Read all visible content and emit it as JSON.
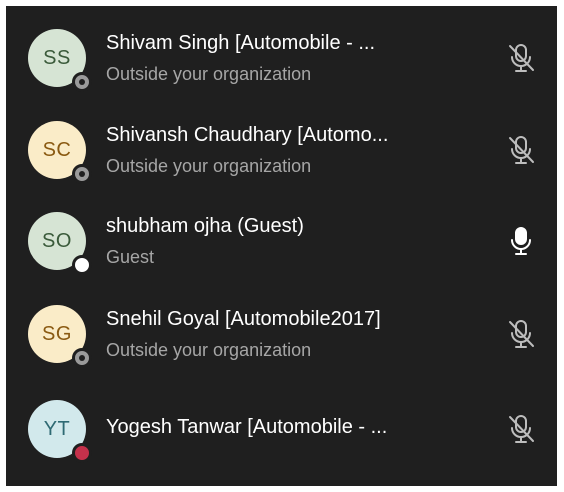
{
  "participants": [
    {
      "initials": "SS",
      "name": "Shivam Singh [Automobile - ...",
      "subtitle": "Outside your organization",
      "avatar_bg": "#d6e4d4",
      "avatar_fg": "#3a5a3a",
      "status": "unknown",
      "mic": "mic-off-icon"
    },
    {
      "initials": "SC",
      "name": "Shivansh Chaudhary [Automo...",
      "subtitle": "Outside your organization",
      "avatar_bg": "#faecc8",
      "avatar_fg": "#8a5a12",
      "status": "unknown",
      "mic": "mic-off-icon"
    },
    {
      "initials": "SO",
      "name": "shubham ojha (Guest)",
      "subtitle": "Guest",
      "avatar_bg": "#d6e4d4",
      "avatar_fg": "#3a5a3a",
      "status": "available",
      "mic": "mic-on-icon"
    },
    {
      "initials": "SG",
      "name": "Snehil Goyal [Automobile2017]",
      "subtitle": "Outside your organization",
      "avatar_bg": "#faecc8",
      "avatar_fg": "#8a5a12",
      "status": "unknown",
      "mic": "mic-off-icon"
    },
    {
      "initials": "YT",
      "name": "Yogesh Tanwar [Automobile - ...",
      "subtitle": "",
      "avatar_bg": "#d2e9ec",
      "avatar_fg": "#2f6a73",
      "status": "busy",
      "mic": "mic-off-icon"
    }
  ]
}
